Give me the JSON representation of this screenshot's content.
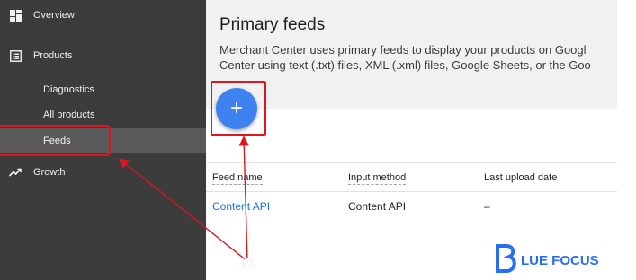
{
  "sidebar": {
    "overview": "Overview",
    "products": "Products",
    "diagnostics": "Diagnostics",
    "all_products": "All products",
    "feeds": "Feeds",
    "growth": "Growth"
  },
  "header": {
    "title": "Primary feeds",
    "description_line1": "Merchant Center uses primary feeds to display your products on Googl",
    "description_line2": "Center using text (.txt) files, XML (.xml) files, Google Sheets, or the Goo"
  },
  "add_button": {
    "label": "+",
    "icon": "plus-icon"
  },
  "table": {
    "columns": [
      "Feed name",
      "Input method",
      "Last upload date"
    ],
    "rows": [
      {
        "feed_name": "Content API",
        "input_method": "Content API",
        "last_upload": "–"
      }
    ]
  },
  "watermark": {
    "text": "LUE FOCUS"
  },
  "colors": {
    "sidebar": "#3c3c3c",
    "accent": "#3e82f1",
    "annotation": "#e0151e",
    "link": "#1a73e8"
  }
}
